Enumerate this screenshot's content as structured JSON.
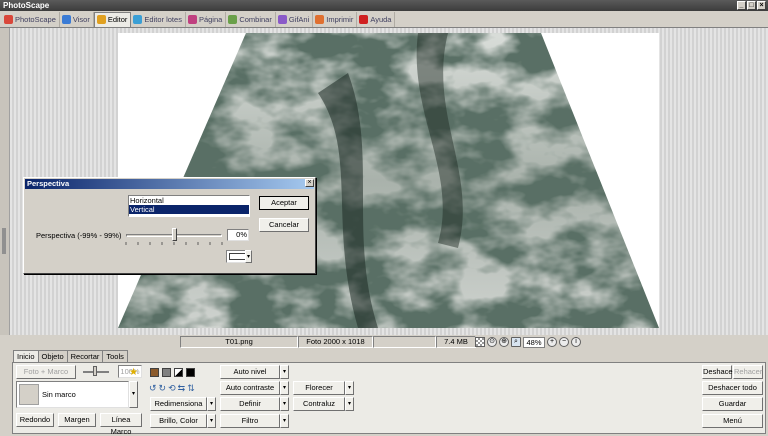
{
  "window": {
    "title": "PhotoScape",
    "controls": [
      "_",
      "□",
      "×"
    ]
  },
  "tabs": [
    {
      "label": "PhotoScape",
      "color": "#d9473a"
    },
    {
      "label": "Visor",
      "color": "#3a7bd5"
    },
    {
      "label": "Editor",
      "color": "#e0a020",
      "active": true
    },
    {
      "label": "Editor lotes",
      "color": "#3a9fd5"
    },
    {
      "label": "Página",
      "color": "#c04080"
    },
    {
      "label": "Combinar",
      "color": "#6aa04a"
    },
    {
      "label": "GifAni",
      "color": "#8a5ac8"
    },
    {
      "label": "Imprimir",
      "color": "#e07030"
    },
    {
      "label": "Ayuda",
      "color": "#d02020"
    }
  ],
  "status": {
    "filename": "T01.png",
    "dimensions": "Foto 2000 x 1018",
    "filesize": "7.4 MB",
    "zoom": "48%"
  },
  "dialog": {
    "title": "Perspectiva",
    "list_items": [
      "Horizontal",
      "Vertical"
    ],
    "selected_item": "Vertical",
    "slider_label": "Perspectiva (-99% - 99%)",
    "slider_value_text": "0%",
    "slider_fraction": 0.5,
    "ok": "Aceptar",
    "cancel": "Cancelar"
  },
  "panel": {
    "tabs": [
      "Inicio",
      "Objeto",
      "Recortar",
      "Tools"
    ],
    "active_tab": "Inicio",
    "foto_marco": "Foto + Marco",
    "percent": "100%",
    "frame_name": "Sin marco",
    "redondo": "Redondo",
    "margen": "Margen",
    "linea_marco": "Línea Marco",
    "redimensiona": "Redimensiona",
    "brillo_color": "Brillo, Color",
    "auto_nivel": "Auto nivel",
    "auto_contraste": "Auto contraste",
    "definir": "Definir",
    "filtro": "Filtro",
    "florecer": "Florecer",
    "contraluz": "Contraluz",
    "deshacer": "Deshacer",
    "rehacer": "Rehacer",
    "deshacer_todo": "Deshacer todo",
    "guardar": "Guardar",
    "menu": "Menú"
  }
}
